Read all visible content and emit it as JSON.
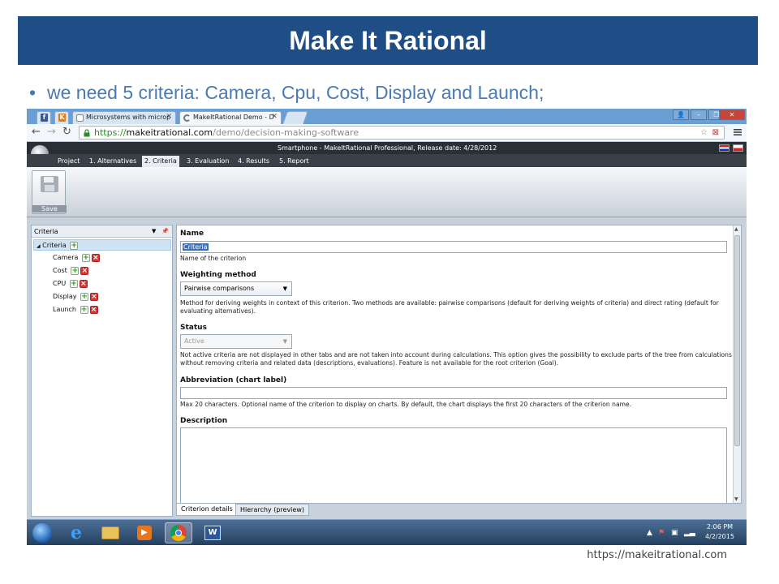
{
  "slide": {
    "title": "Make It Rational",
    "bullet": "we need 5 criteria: Camera, Cpu, Cost, Display and Launch;",
    "footer_url": "https://makeitrational.com"
  },
  "browser": {
    "tabs": [
      {
        "label": "Microsystems with microp",
        "icon": "page-icon"
      },
      {
        "label": "MakeItRational Demo - D",
        "icon": "loading-icon",
        "active": true
      }
    ],
    "url": {
      "scheme": "https://",
      "host": "makeitrational.com",
      "path": "/demo/decision-making-software"
    }
  },
  "app": {
    "header_title": "Smartphone - MakeItRational Professional, Release date: 4/28/2012",
    "tabs": [
      {
        "label": "Project"
      },
      {
        "label": "1. Alternatives"
      },
      {
        "label": "2. Criteria",
        "active": true
      },
      {
        "label": "3. Evaluation"
      },
      {
        "label": "4. Results"
      },
      {
        "label": "5. Report"
      }
    ],
    "save_label": "Save",
    "tree_panel_title": "Criteria",
    "tree": {
      "root": "Criteria",
      "children": [
        "Camera",
        "Cost",
        "CPU",
        "Display",
        "Launch"
      ]
    },
    "form": {
      "name_label": "Name",
      "name_value": "Criteria",
      "name_help": "Name of the criterion",
      "weighting_label": "Weighting method",
      "weighting_value": "Pairwise comparisons",
      "weighting_help": "Method for deriving weights in context of this criterion. Two methods are available: pairwise comparisons (default for deriving weights of criteria) and direct rating (default for evaluating alternatives).",
      "status_label": "Status",
      "status_value": "Active",
      "status_help": "Not active criteria are not displayed in other tabs and are not taken into account during calculations. This option gives the possibility to exclude parts of the tree from calculations without removing criteria and related data (descriptions, evaluations). Feature is not available for the root criterion (Goal).",
      "abbrev_label": "Abbreviation (chart label)",
      "abbrev_value": "",
      "abbrev_help": "Max 20 characters. Optional name of the criterion to display on charts. By default, the chart displays the first 20 characters of the criterion name.",
      "description_label": "Description"
    },
    "bottom_tabs": [
      {
        "label": "Criterion details",
        "active": true
      },
      {
        "label": "Hierarchy (preview)"
      }
    ]
  },
  "taskbar": {
    "time": "2:06 PM",
    "date": "4/2/2015"
  },
  "colors": {
    "title_bg": "#1f4e86",
    "bullet_text": "#4a7ab0",
    "chrome_frame": "#6a9fd3",
    "url_green": "#2b8a2b"
  }
}
